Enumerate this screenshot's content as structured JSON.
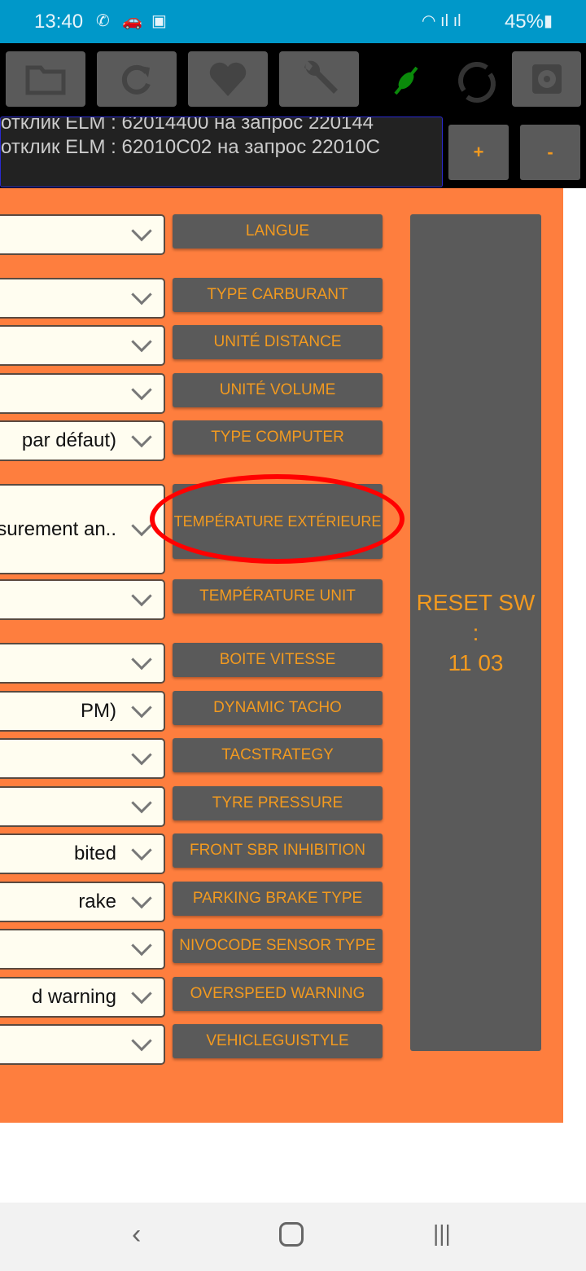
{
  "status_bar": {
    "time": "13:40",
    "battery": "45%"
  },
  "toolbar": {
    "icons": [
      "folder-icon",
      "refresh-icon",
      "heart-icon",
      "wrench-icon",
      "plug-connected-icon",
      "sync-icon",
      "settings-icon"
    ]
  },
  "log": {
    "lines": [
      "отклик ELM : 62014400 на запрос 220144",
      "отклик ELM : 62010C02 на запрос 22010C"
    ]
  },
  "zoom": {
    "plus": "+",
    "minus": "-"
  },
  "rows": [
    {
      "value": "",
      "label": "LANGUE"
    },
    {
      "value": "",
      "label": "TYPE CARBURANT"
    },
    {
      "value": "",
      "label": "UNITÉ DISTANCE"
    },
    {
      "value": "",
      "label": "UNITÉ VOLUME"
    },
    {
      "value": "par défaut)",
      "label": "TYPE COMPUTER"
    },
    {
      "value": "easurement an..",
      "label": "TEMPÉRATURE EXTÉRIEURE"
    },
    {
      "value": "",
      "label": "TEMPÉRATURE UNIT"
    },
    {
      "value": "",
      "label": "BOITE VITESSE"
    },
    {
      "value": "PM)",
      "label": "DYNAMIC TACHO"
    },
    {
      "value": "",
      "label": "TACSTRATEGY"
    },
    {
      "value": "",
      "label": "TYRE PRESSURE"
    },
    {
      "value": "bited",
      "label": "FRONT SBR INHIBITION"
    },
    {
      "value": "rake",
      "label": "PARKING BRAKE TYPE"
    },
    {
      "value": "",
      "label": "NIVOCODE SENSOR TYPE"
    },
    {
      "value": "d warning",
      "label": "OVERSPEED WARNING"
    },
    {
      "value": "",
      "label": "VEHICLEGUISTYLE"
    }
  ],
  "reset": {
    "line1": "RESET SW :",
    "line2": "11 03"
  },
  "colors": {
    "accent": "#f39a1f",
    "panel": "#fe7e3e",
    "button": "#5a5a5a",
    "highlight": "#ff0000"
  }
}
